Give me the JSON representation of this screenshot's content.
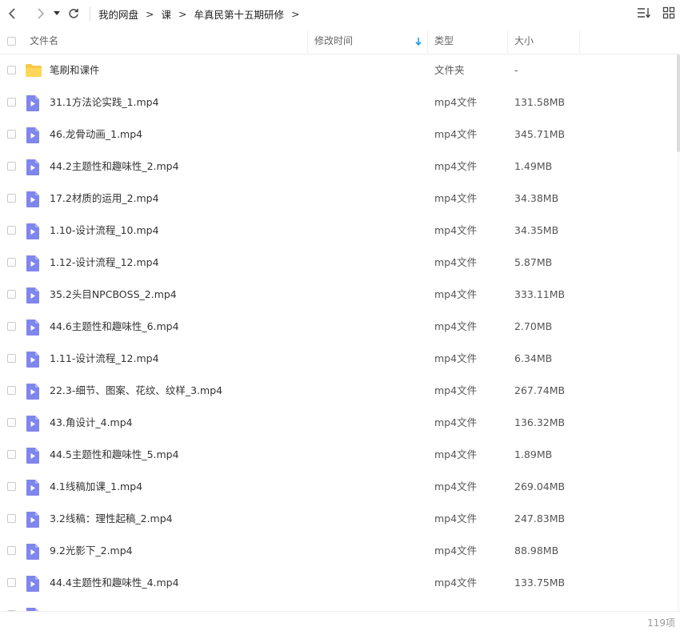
{
  "breadcrumb": [
    "我的网盘",
    "课",
    "牟真民第十五期研修"
  ],
  "columns": {
    "name": "文件名",
    "modified": "修改时间",
    "type": "类型",
    "size": "大小"
  },
  "files": [
    {
      "name": "笔刷和课件",
      "type": "文件夹",
      "size": "-",
      "kind": "folder"
    },
    {
      "name": "31.1方法论实践_1.mp4",
      "type": "mp4文件",
      "size": "131.58MB",
      "kind": "video"
    },
    {
      "name": "46.龙骨动画_1.mp4",
      "type": "mp4文件",
      "size": "345.71MB",
      "kind": "video"
    },
    {
      "name": "44.2主题性和趣味性_2.mp4",
      "type": "mp4文件",
      "size": "1.49MB",
      "kind": "video"
    },
    {
      "name": "17.2材质的运用_2.mp4",
      "type": "mp4文件",
      "size": "34.38MB",
      "kind": "video"
    },
    {
      "name": "1.10-设计流程_10.mp4",
      "type": "mp4文件",
      "size": "34.35MB",
      "kind": "video"
    },
    {
      "name": "1.12-设计流程_12.mp4",
      "type": "mp4文件",
      "size": "5.87MB",
      "kind": "video"
    },
    {
      "name": "35.2头目NPCBOSS_2.mp4",
      "type": "mp4文件",
      "size": "333.11MB",
      "kind": "video"
    },
    {
      "name": "44.6主题性和趣味性_6.mp4",
      "type": "mp4文件",
      "size": "2.70MB",
      "kind": "video"
    },
    {
      "name": "1.11-设计流程_12.mp4",
      "type": "mp4文件",
      "size": "6.34MB",
      "kind": "video"
    },
    {
      "name": "22.3-细节、图案、花纹、纹样_3.mp4",
      "type": "mp4文件",
      "size": "267.74MB",
      "kind": "video"
    },
    {
      "name": "43.角设计_4.mp4",
      "type": "mp4文件",
      "size": "136.32MB",
      "kind": "video"
    },
    {
      "name": "44.5主题性和趣味性_5.mp4",
      "type": "mp4文件",
      "size": "1.89MB",
      "kind": "video"
    },
    {
      "name": "4.1线稿加课_1.mp4",
      "type": "mp4文件",
      "size": "269.04MB",
      "kind": "video"
    },
    {
      "name": "3.2线稿：理性起稿_2.mp4",
      "type": "mp4文件",
      "size": "247.83MB",
      "kind": "video"
    },
    {
      "name": "9.2光影下_2.mp4",
      "type": "mp4文件",
      "size": "88.98MB",
      "kind": "video"
    },
    {
      "name": "44.4主题性和趣味性_4.mp4",
      "type": "mp4文件",
      "size": "133.75MB",
      "kind": "video"
    },
    {
      "name": "",
      "type": "",
      "size": "",
      "kind": "video"
    }
  ],
  "footer": {
    "count": "119项"
  },
  "colors": {
    "accent": "#1e9bf0",
    "video_icon": "#7f86ec",
    "folder_icon": "#f7c948"
  }
}
